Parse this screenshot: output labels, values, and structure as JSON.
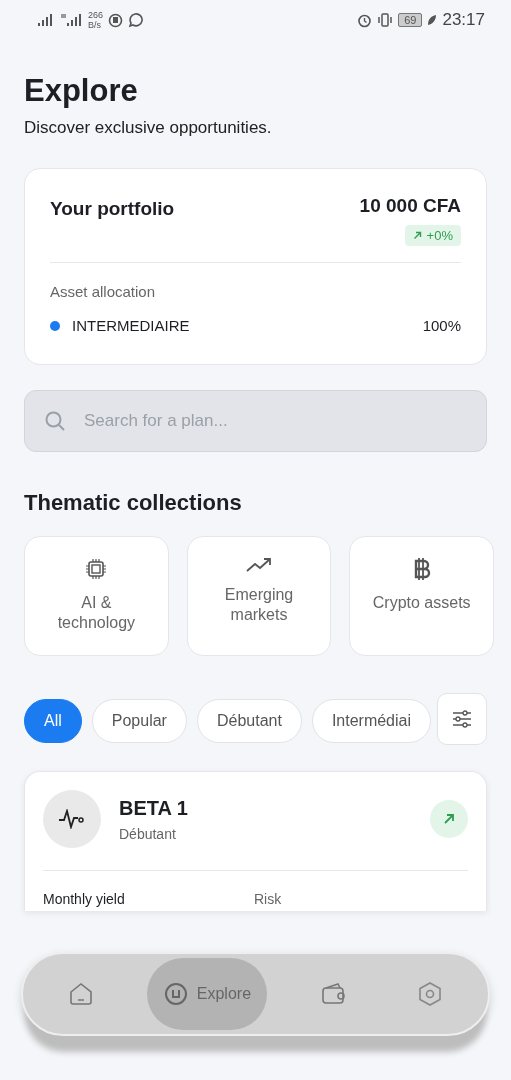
{
  "status_bar": {
    "net_speed_value": "266",
    "net_speed_unit": "B/s",
    "battery": "69",
    "time": "23:17"
  },
  "header": {
    "title": "Explore",
    "subtitle": "Discover exclusive opportunities."
  },
  "portfolio": {
    "title": "Your portfolio",
    "value": "10 000 CFA",
    "change": "+0%",
    "allocation_title": "Asset allocation",
    "allocations": [
      {
        "name": "INTERMEDIAIRE",
        "share": "100%",
        "color": "#1a7cf0"
      }
    ]
  },
  "search": {
    "placeholder": "Search for a plan..."
  },
  "collections": {
    "title": "Thematic collections",
    "items": [
      {
        "kind": "chip",
        "label": "AI & technology"
      },
      {
        "kind": "trend",
        "label": "Emerging markets"
      },
      {
        "kind": "bitcoin",
        "label": "Crypto assets"
      }
    ]
  },
  "filters": [
    {
      "label": "All",
      "selected": true
    },
    {
      "label": "Popular",
      "selected": false
    },
    {
      "label": "Débutant",
      "selected": false
    },
    {
      "label": "Intermédiai",
      "selected": false
    }
  ],
  "plans": [
    {
      "name": "BETA 1",
      "level": "Débutant",
      "col_1": "Monthly yield",
      "col_2": "Risk"
    }
  ],
  "nav": [
    {
      "kind": "home",
      "selected": false
    },
    {
      "kind": "explore",
      "label": "Explore",
      "selected": true
    },
    {
      "kind": "wallet",
      "selected": false
    },
    {
      "kind": "settings",
      "selected": false
    }
  ]
}
